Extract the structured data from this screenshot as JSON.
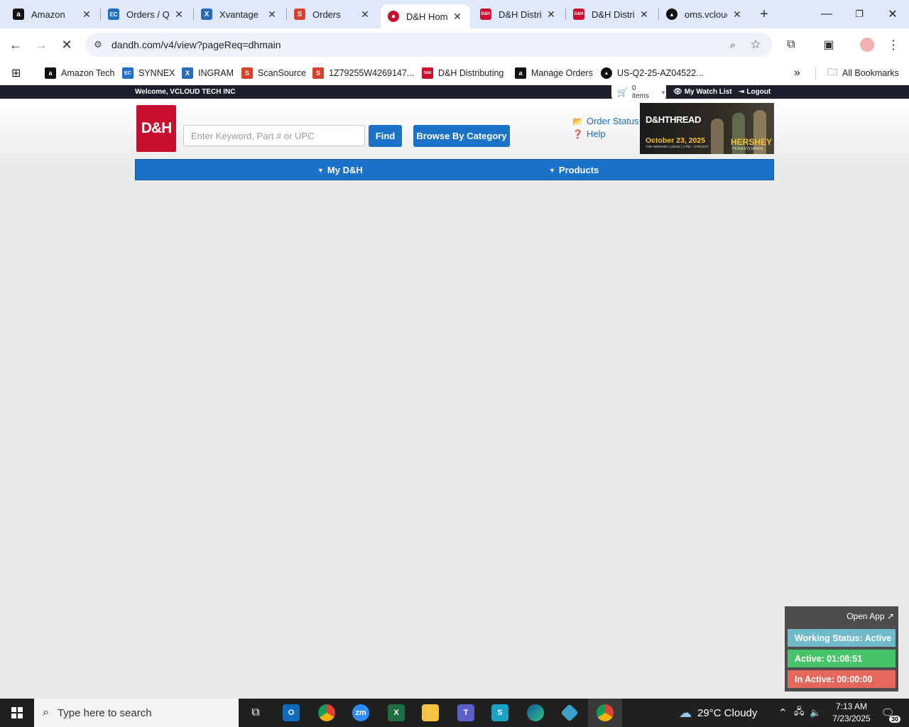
{
  "browser": {
    "tabs": [
      {
        "title": "Amazon",
        "icon": "amazon-icon",
        "color": "#111111",
        "glyph": "a"
      },
      {
        "title": "Orders / Quo",
        "icon": "ec-icon",
        "color": "#1e6fd0",
        "glyph": "EC"
      },
      {
        "title": "Xvantage",
        "icon": "xvantage-icon",
        "color": "#2a6bb8",
        "glyph": "X"
      },
      {
        "title": "Orders",
        "icon": "scansource-icon",
        "color": "#d9412b",
        "glyph": "S"
      },
      {
        "title": "D&H Home",
        "icon": "dh-icon",
        "color": "#c8102e",
        "glyph": "●"
      },
      {
        "title": "D&H Distrib",
        "icon": "dh-icon",
        "color": "#c8102e",
        "glyph": "D&H"
      },
      {
        "title": "D&H Distrib",
        "icon": "dh-icon",
        "color": "#c8102e",
        "glyph": "D&H"
      },
      {
        "title": "oms.vcloud",
        "icon": "oms-icon",
        "color": "#111111",
        "glyph": "▲"
      }
    ],
    "active_tab": 4,
    "new_tab": "+",
    "url": "dandh.com/v4/view?pageReq=dhmain",
    "bookmarks": [
      {
        "label": "Amazon Tech",
        "color": "#111111",
        "glyph": "a"
      },
      {
        "label": "SYNNEX",
        "color": "#1e6fd0",
        "glyph": "EC"
      },
      {
        "label": "INGRAM",
        "color": "#2a6bb8",
        "glyph": "X"
      },
      {
        "label": "ScanSource",
        "color": "#d9412b",
        "glyph": "S"
      },
      {
        "label": "1Z79255W4269147...",
        "color": "#d9412b",
        "glyph": "S"
      },
      {
        "label": "D&H Distributing",
        "color": "#c8102e",
        "glyph": "D&H"
      },
      {
        "label": "Manage Orders",
        "color": "#111111",
        "glyph": "a"
      },
      {
        "label": "US-Q2-25-AZ04522...",
        "color": "#111111",
        "glyph": "▲"
      }
    ],
    "all_bookmarks": "All Bookmarks",
    "more": "»"
  },
  "site": {
    "welcome": "Welcome, VCLOUD TECH INC",
    "cart": "0 items",
    "watch_list": "My Watch List",
    "logout": "Logout",
    "logo": "D&H",
    "search_placeholder": "Enter Keyword, Part # or UPC",
    "find": "Find",
    "browse": "Browse By Category",
    "order_status": "Order Status",
    "help": "Help",
    "banner": {
      "title": "D&HTHREAD",
      "date": "October 23, 2025",
      "sub": "THE HERSHEY LODGE | 1 PM – 3 PM EST",
      "city": "HERSHEY",
      "state": "PENNSYLVANIA"
    },
    "nav": [
      "My D&H",
      "Products"
    ],
    "brand_color": "#c8102e",
    "accent_color": "#1a73c8"
  },
  "widget": {
    "open_app": "Open App ↗",
    "working_status": "Working Status: Active",
    "active": "Active: 01:08:51",
    "inactive": "In Active: 00:00:00",
    "colors": {
      "status": "#6fb9c9",
      "active": "#47c46a",
      "inactive": "#e5675c"
    }
  },
  "taskbar": {
    "search_placeholder": "Type here to search",
    "weather": "29°C  Cloudy",
    "time": "7:13 AM",
    "date": "7/23/2025",
    "notifications": "30"
  }
}
